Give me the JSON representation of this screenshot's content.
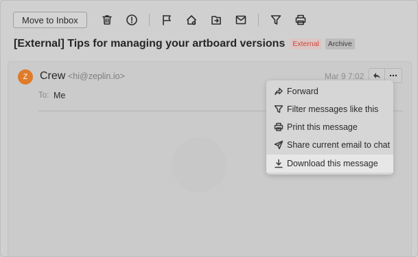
{
  "toolbar": {
    "move_to_inbox": "Move to Inbox",
    "icons": [
      "trash-icon",
      "spam-icon",
      "flag-icon",
      "snooze-icon",
      "move-folder-icon",
      "mark-read-icon",
      "filter-icon",
      "print-icon"
    ]
  },
  "subject": {
    "title": "[External] Tips for managing your artboard versions",
    "tag_external": "External",
    "tag_archive": "Archive"
  },
  "message": {
    "avatar_initial": "Z",
    "sender_name": "Crew",
    "sender_email": "<hi@zeplin.io>",
    "date": "Mar 9 7:02",
    "to_label": "To:",
    "to_value": "Me"
  },
  "menu": {
    "items": [
      {
        "label": "Forward",
        "icon": "forward-icon"
      },
      {
        "label": "Filter messages like this",
        "icon": "filter-icon"
      },
      {
        "label": "Print this message",
        "icon": "print-icon"
      },
      {
        "label": "Share current email to chat",
        "icon": "send-icon"
      },
      {
        "label": "Download this message",
        "icon": "download-icon"
      }
    ],
    "highlighted_index": 4
  },
  "colors": {
    "avatar": "#e07b2a",
    "external_tag_text": "#c9473b",
    "overlay_bg": "#d0d0d0"
  }
}
